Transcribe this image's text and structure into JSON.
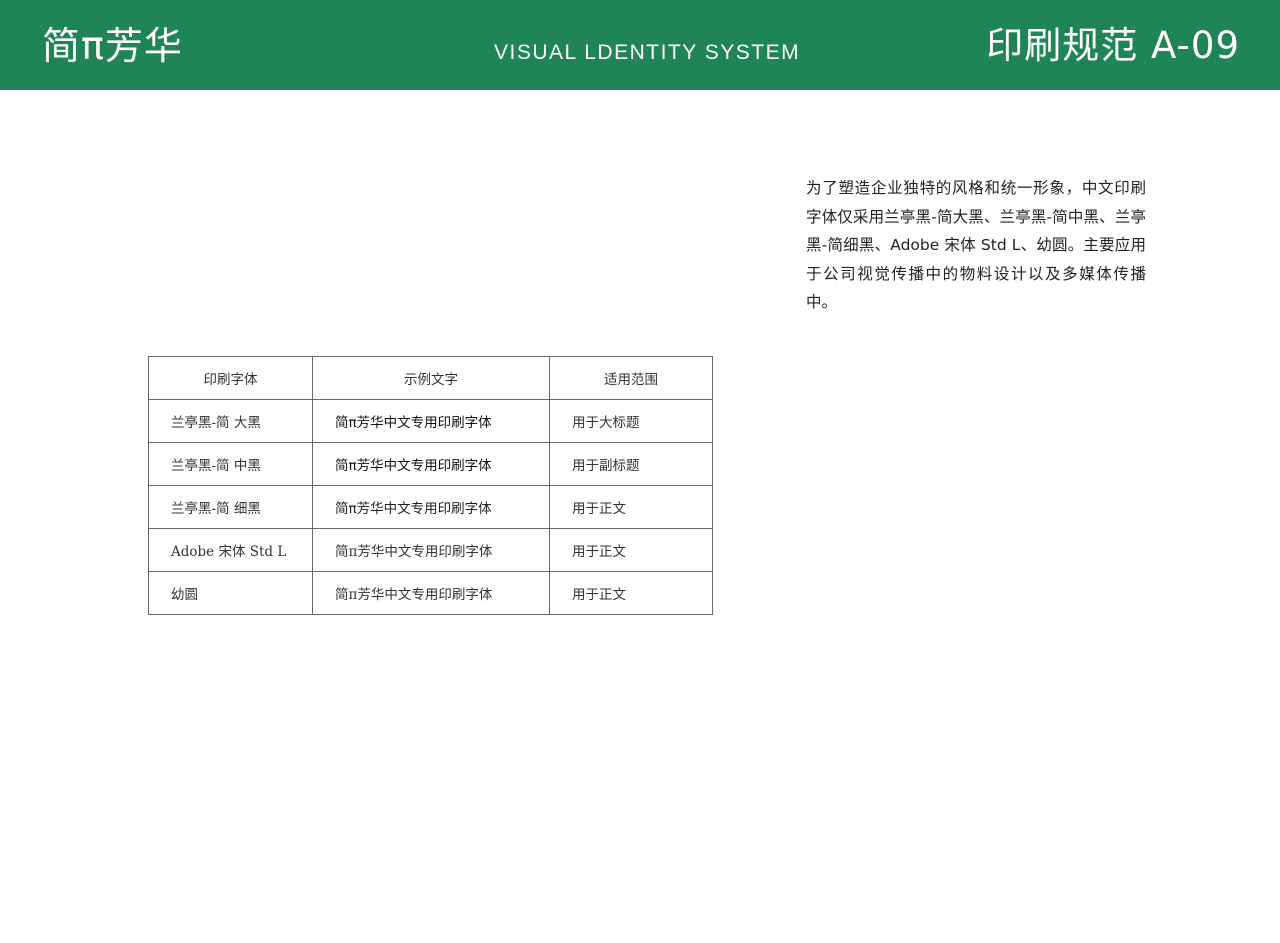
{
  "header": {
    "brand": "简π芳华",
    "subtitle": "VISUAL LDENTITY SYSTEM",
    "section_code": "印刷规范 A-09"
  },
  "intro": {
    "text": "为了塑造企业独特的风格和统一形象，中文印刷字体仅采用兰亭黑-简大黑、兰亭黑-简中黑、兰亭黑-简细黑、Adobe 宋体 Std L、幼圆。主要应用于公司视觉传播中的物料设计以及多媒体传播中。"
  },
  "font_table": {
    "headers": [
      "印刷字体",
      "示例文字",
      "适用范围"
    ],
    "rows": [
      {
        "font": "兰亭黑-简 大黑",
        "sample": "简π芳华中文专用印刷字体",
        "usage": "用于大标题"
      },
      {
        "font": "兰亭黑-简 中黑",
        "sample": "简π芳华中文专用印刷字体",
        "usage": "用于副标题"
      },
      {
        "font": "兰亭黑-简 细黑",
        "sample": "简π芳华中文专用印刷字体",
        "usage": "用于正文"
      },
      {
        "font": "Adobe 宋体 Std L",
        "sample": "简π芳华中文专用印刷字体",
        "usage": "用于正文"
      },
      {
        "font": "幼圆",
        "sample": "简π芳华中文专用印刷字体",
        "usage": "用于正文"
      }
    ]
  },
  "colors": {
    "header_bg": "#1f8456",
    "header_text": "#ffffff",
    "table_border": "#666666"
  }
}
